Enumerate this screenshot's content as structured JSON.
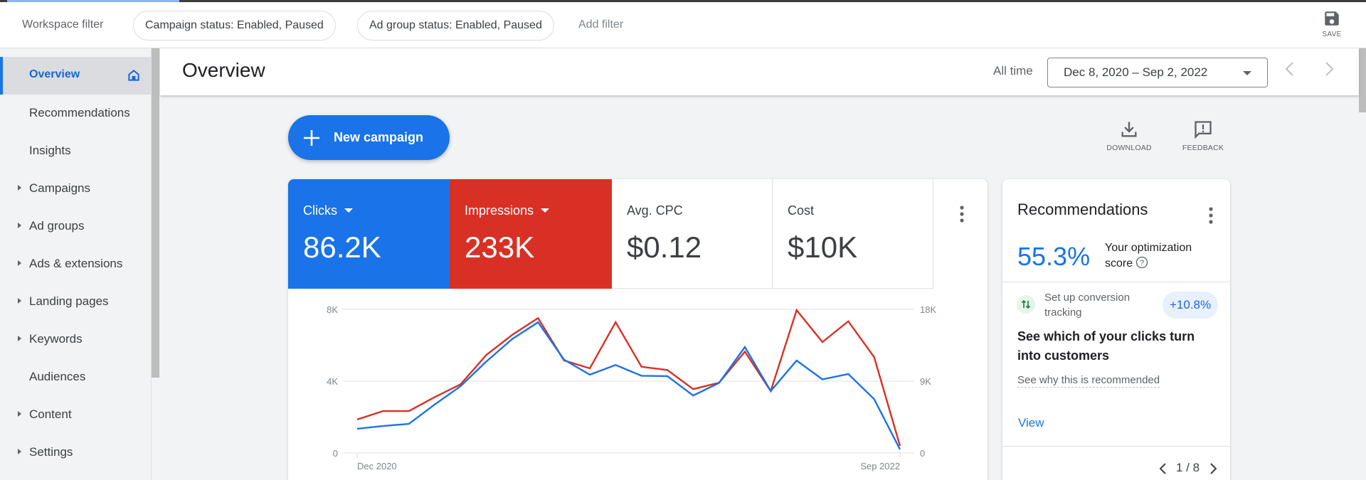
{
  "topbar": {
    "workspace_filter_label": "Workspace filter",
    "filters": [
      "Campaign status: Enabled, Paused",
      "Ad group status: Enabled, Paused"
    ],
    "add_filter_label": "Add filter",
    "save_label": "SAVE"
  },
  "sidebar": {
    "items": [
      {
        "label": "Overview",
        "active": true,
        "expandable": false,
        "icon": "home-icon"
      },
      {
        "label": "Recommendations",
        "active": false,
        "expandable": false
      },
      {
        "label": "Insights",
        "active": false,
        "expandable": false
      },
      {
        "label": "Campaigns",
        "active": false,
        "expandable": true
      },
      {
        "label": "Ad groups",
        "active": false,
        "expandable": true
      },
      {
        "label": "Ads & extensions",
        "active": false,
        "expandable": true
      },
      {
        "label": "Landing pages",
        "active": false,
        "expandable": true
      },
      {
        "label": "Keywords",
        "active": false,
        "expandable": true
      },
      {
        "label": "Audiences",
        "active": false,
        "expandable": false
      },
      {
        "label": "Content",
        "active": false,
        "expandable": true
      },
      {
        "label": "Settings",
        "active": false,
        "expandable": true
      }
    ]
  },
  "header": {
    "title": "Overview",
    "date_preset": "All time",
    "date_range": "Dec 8, 2020 – Sep 2, 2022"
  },
  "actions": {
    "new_campaign_label": "New campaign",
    "download_label": "DOWNLOAD",
    "feedback_label": "FEEDBACK"
  },
  "metrics": [
    {
      "label": "Clicks",
      "value": "86.2K",
      "selected": true,
      "color": "#1a73e8"
    },
    {
      "label": "Impressions",
      "value": "233K",
      "selected": true,
      "color": "#d93025"
    },
    {
      "label": "Avg. CPC",
      "value": "$0.12",
      "selected": false
    },
    {
      "label": "Cost",
      "value": "$10K",
      "selected": false
    }
  ],
  "chart_data": {
    "type": "line",
    "title": "",
    "xlabel": "",
    "ylabel": "",
    "x_tick_labels": [
      "Dec 2020",
      "Sep 2022"
    ],
    "y_left": {
      "ticks": [
        "0",
        "4K",
        "8K"
      ],
      "range": [
        0,
        8000
      ]
    },
    "y_right": {
      "ticks": [
        "0",
        "9K",
        "18K"
      ],
      "range": [
        0,
        18000
      ]
    },
    "grid": true,
    "series": [
      {
        "name": "Clicks",
        "axis": "left",
        "color": "#1a73e8",
        "values": [
          1350,
          1500,
          1620,
          2700,
          3720,
          5100,
          6350,
          7280,
          5200,
          4360,
          4900,
          4300,
          4280,
          3200,
          3900,
          5900,
          3450,
          5150,
          4100,
          4400,
          3000,
          200
        ]
      },
      {
        "name": "Impressions",
        "axis": "right",
        "color": "#d93025",
        "values": [
          4200,
          5250,
          5250,
          7000,
          8600,
          12300,
          14800,
          16900,
          11600,
          10600,
          16400,
          10800,
          10400,
          8000,
          8800,
          12700,
          7750,
          17900,
          13900,
          16500,
          12000,
          900
        ]
      }
    ]
  },
  "recommendations": {
    "title": "Recommendations",
    "score": "55.3%",
    "score_label": "Your optimization score",
    "item": {
      "type": "Set up conversion tracking",
      "impact": "+10.8%",
      "headline": "See which of your clicks turn into customers",
      "why_link": "See why this is recommended",
      "view_label": "View"
    },
    "pager": "1 / 8"
  }
}
